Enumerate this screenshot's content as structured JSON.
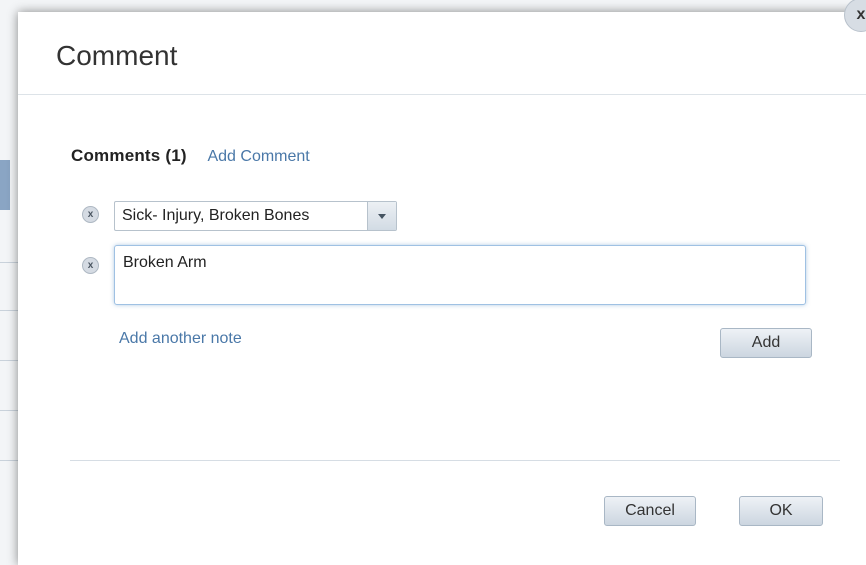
{
  "dialog": {
    "title": "Comment",
    "close_label": "x"
  },
  "comments": {
    "header_label": "Comments (1)",
    "add_comment_label": "Add Comment",
    "category_value": "Sick- Injury, Broken Bones",
    "note_value": "Broken Arm",
    "remove_label": "x",
    "add_another_note_label": "Add another note",
    "add_button_label": "Add"
  },
  "footer": {
    "cancel_label": "Cancel",
    "ok_label": "OK"
  }
}
